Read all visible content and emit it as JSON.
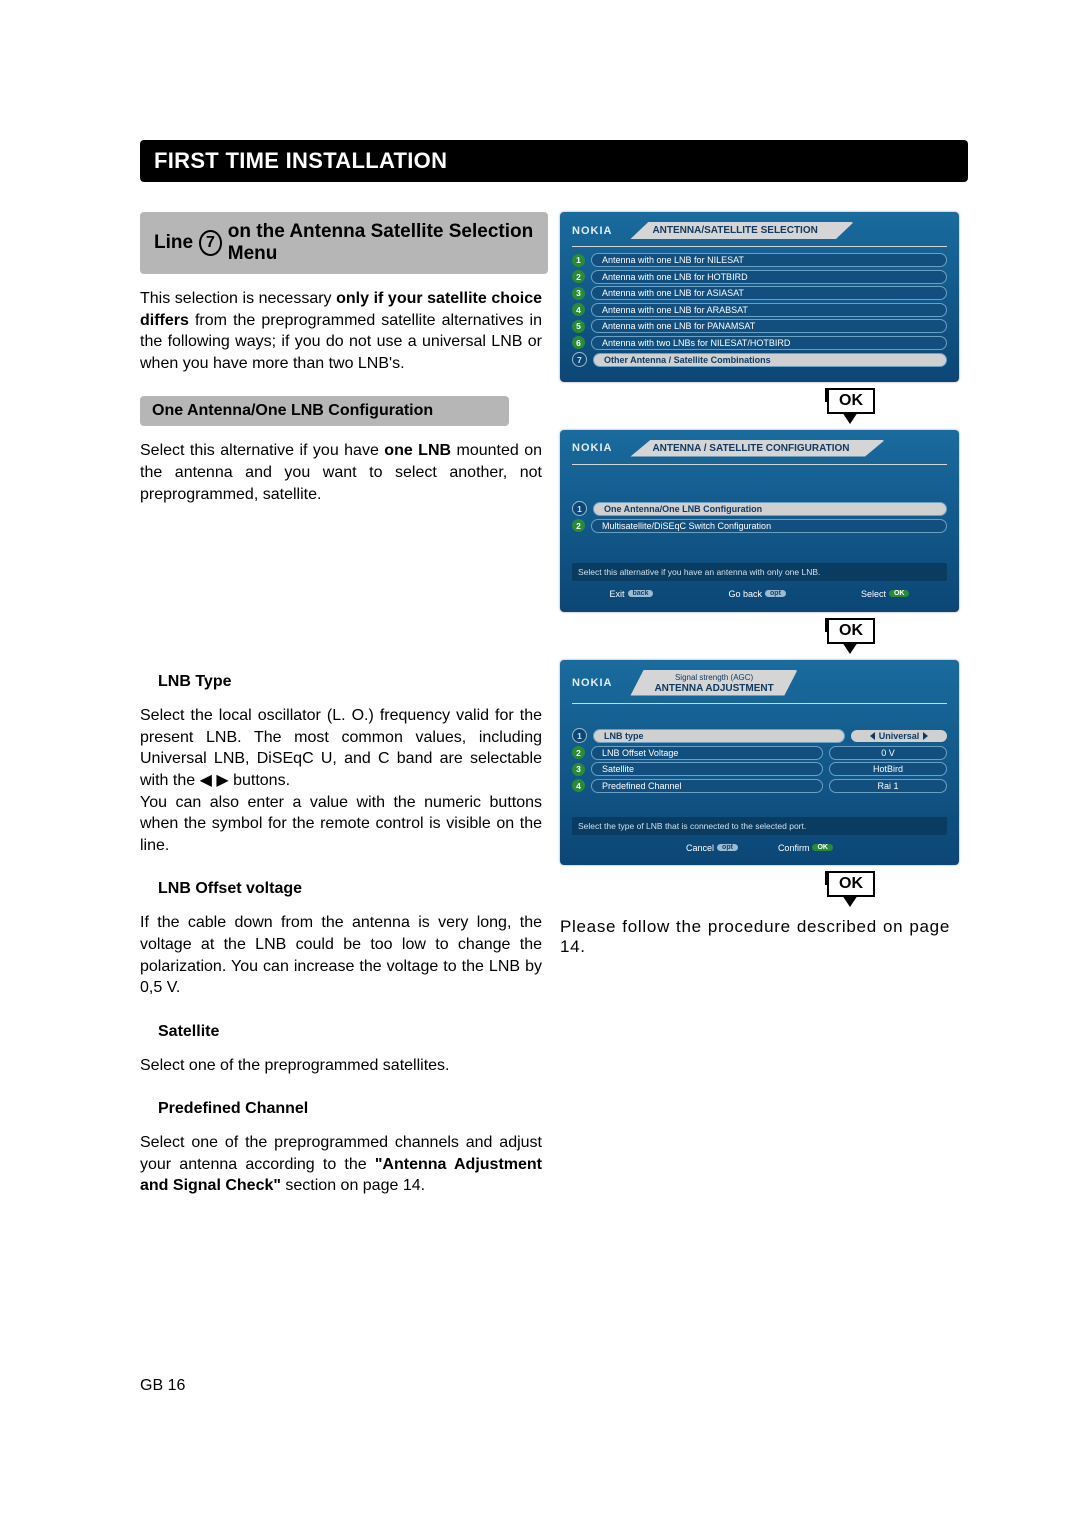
{
  "header": "FIRST TIME INSTALLATION",
  "subheader_pre": "Line",
  "subheader_num": "7",
  "subheader_post": "on the Antenna Satellite Selection Menu",
  "intro1": "This selection is necessary ",
  "intro1_bold": "only if your satellite choice differs",
  "intro2": " from the preprogrammed satellite alternatives in the following ways; if you do not use a universal LNB or when you have more than two LNB's.",
  "section_one": "One Antenna/One LNB Configuration",
  "section_one_body_a": "Select this alternative if you have ",
  "section_one_bold": "one LNB",
  "section_one_body_b": " mounted on the antenna and you want to select another, not preprogrammed, satellite.",
  "lnb_type_h": "LNB Type",
  "lnb_type_body": "Select the local oscillator (L. O.) frequency valid for the present LNB. The most common values, including Universal LNB, DiSEqC U, and C band are selectable with the ◀ ▶ buttons.\nYou can also enter a value with the numeric buttons when the symbol for the remote control is visible on the line.",
  "lnb_offset_h": "LNB Offset voltage",
  "lnb_offset_body": "If the cable down from the antenna is very long, the voltage at the LNB could be too low to change the polarization. You can increase the voltage to the LNB by 0,5 V.",
  "sat_h": "Satellite",
  "sat_body": "Select one of the preprogrammed satellites.",
  "pre_h": "Predefined Channel",
  "pre_body_a": "Select one of the preprogrammed channels and adjust your antenna according to the ",
  "pre_bold": "\"Antenna Adjustment and Signal Check\"",
  "pre_body_b": " section on page 14.",
  "note": "Please follow the procedure described on page 14.",
  "footer": "GB 16",
  "ok": "OK",
  "brand": "NOKIA",
  "screen1": {
    "title": "ANTENNA/SATELLITE SELECTION",
    "items": [
      "Antenna with one LNB for NILESAT",
      "Antenna with one LNB for HOTBIRD",
      "Antenna with one LNB for ASIASAT",
      "Antenna with one LNB for ARABSAT",
      "Antenna with one LNB for PANAMSAT",
      "Antenna with two LNBs for NILESAT/HOTBIRD",
      "Other Antenna / Satellite Combinations"
    ]
  },
  "screen2": {
    "title": "ANTENNA / SATELLITE CONFIGURATION",
    "items": [
      "One Antenna/One LNB Configuration",
      "Multisatellite/DiSEqC Switch Configuration"
    ],
    "help": "Select this alternative if you have an antenna with only one LNB.",
    "btn_exit": "Exit",
    "btn_back": "Go back",
    "btn_select": "Select"
  },
  "screen3": {
    "title_top": "Signal strength (AGC)",
    "title": "ANTENNA ADJUSTMENT",
    "rows": [
      {
        "label": "LNB type",
        "value": "Universal",
        "selected": true
      },
      {
        "label": "LNB Offset Voltage",
        "value": "0 V"
      },
      {
        "label": "Satellite",
        "value": "HotBird"
      },
      {
        "label": "Predefined Channel",
        "value": "Rai 1"
      }
    ],
    "help": "Select the type of LNB that is connected to the selected port.",
    "btn_cancel": "Cancel",
    "btn_confirm": "Confirm"
  }
}
